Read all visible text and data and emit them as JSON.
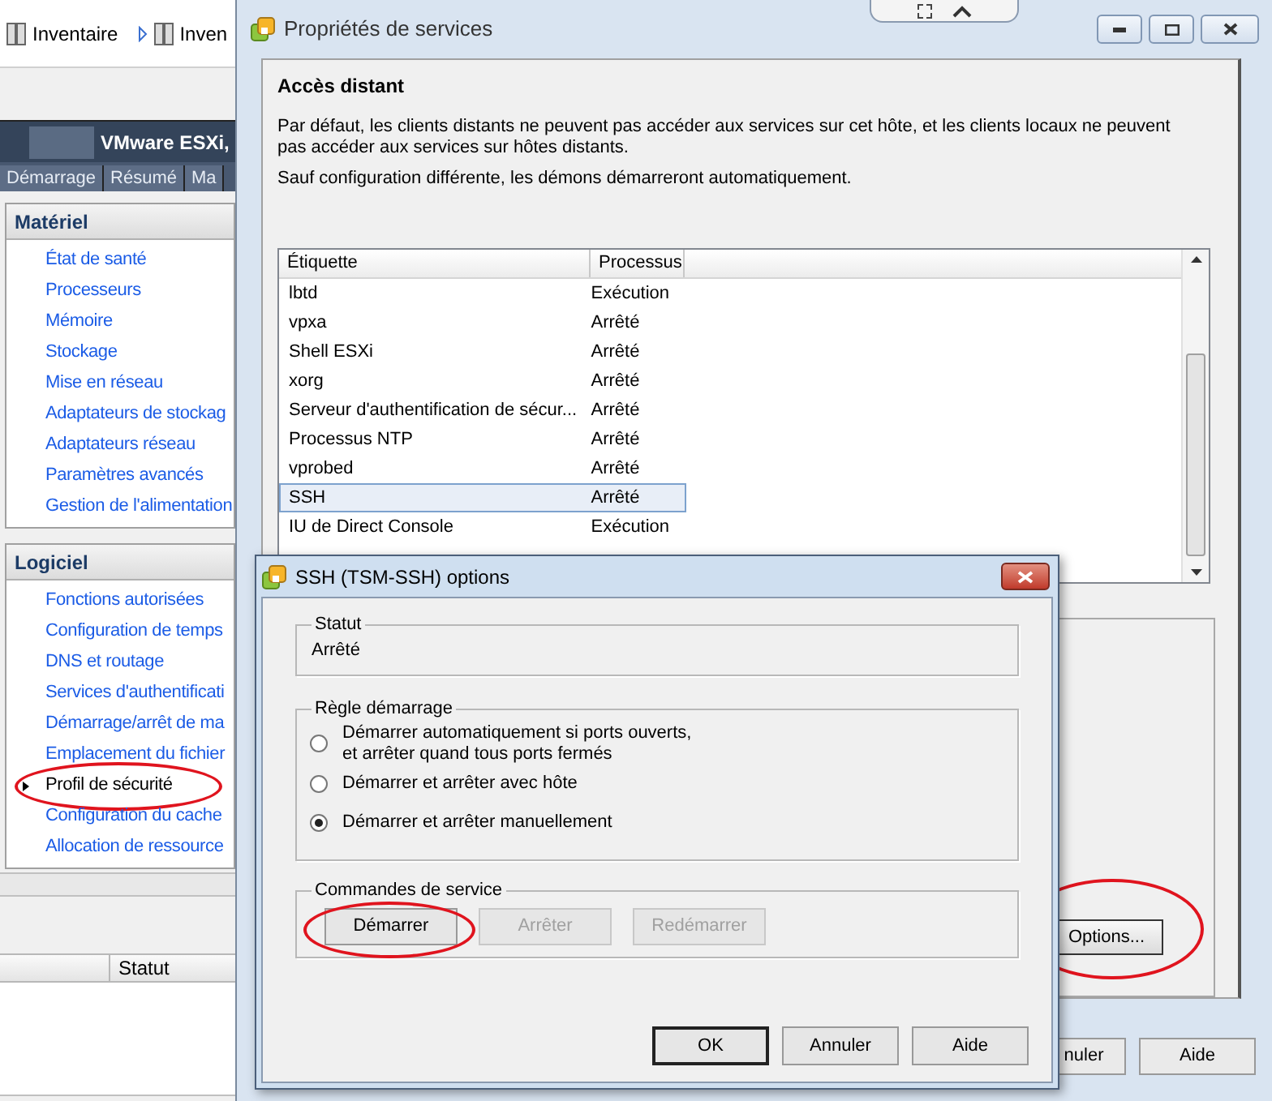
{
  "background_app": {
    "toolbar": [
      {
        "label": "Inventaire"
      },
      {
        "label": "Inven"
      }
    ],
    "host_title": "VMware ESXi,",
    "tabs": [
      {
        "label": "Démarrage"
      },
      {
        "label": "Résumé"
      },
      {
        "label": "Ma"
      }
    ],
    "sections": [
      {
        "title": "Matériel",
        "items": [
          {
            "label": "État de santé",
            "selected": false,
            "circled": false
          },
          {
            "label": "Processeurs",
            "selected": false,
            "circled": false
          },
          {
            "label": "Mémoire",
            "selected": false,
            "circled": false
          },
          {
            "label": "Stockage",
            "selected": false,
            "circled": false
          },
          {
            "label": "Mise en réseau",
            "selected": false,
            "circled": false
          },
          {
            "label": "Adaptateurs de stockag",
            "selected": false,
            "circled": false
          },
          {
            "label": "Adaptateurs réseau",
            "selected": false,
            "circled": false
          },
          {
            "label": "Paramètres avancés",
            "selected": false,
            "circled": false
          },
          {
            "label": "Gestion de l'alimentation",
            "selected": false,
            "circled": false
          }
        ]
      },
      {
        "title": "Logiciel",
        "items": [
          {
            "label": "Fonctions autorisées",
            "selected": false,
            "circled": false
          },
          {
            "label": "Configuration de temps",
            "selected": false,
            "circled": false
          },
          {
            "label": "DNS et routage",
            "selected": false,
            "circled": false
          },
          {
            "label": "Services d'authentificati",
            "selected": false,
            "circled": false
          },
          {
            "label": "Démarrage/arrêt de ma",
            "selected": false,
            "circled": false
          },
          {
            "label": "Emplacement du fichier",
            "selected": false,
            "circled": false
          },
          {
            "label": "Profil de sécurité",
            "selected": true,
            "circled": true
          },
          {
            "label": "Configuration du cache",
            "selected": false,
            "circled": false
          },
          {
            "label": "Allocation de ressource",
            "selected": false,
            "circled": false
          }
        ]
      }
    ],
    "bottom_table": {
      "columns": [
        "Statut"
      ]
    }
  },
  "properties_window": {
    "title": "Propriétés de services",
    "heading": "Accès distant",
    "paragraphs": [
      "Par défaut, les clients distants ne peuvent pas accéder aux services sur cet hôte, et les clients locaux ne peuvent pas accéder aux services sur hôtes distants.",
      "Sauf configuration différente, les démons démarreront automatiquement."
    ],
    "table": {
      "columns": [
        "Étiquette",
        "Processus"
      ],
      "rows": [
        {
          "label": "lbtd",
          "process": "Exécution",
          "selected": false
        },
        {
          "label": "vpxa",
          "process": "Arrêté",
          "selected": false
        },
        {
          "label": "Shell ESXi",
          "process": "Arrêté",
          "selected": false
        },
        {
          "label": "xorg",
          "process": "Arrêté",
          "selected": false
        },
        {
          "label": "Serveur d'authentification de sécur...",
          "process": "Arrêté",
          "selected": false
        },
        {
          "label": "Processus NTP",
          "process": "Arrêté",
          "selected": false
        },
        {
          "label": "vprobed",
          "process": "Arrêté",
          "selected": false
        },
        {
          "label": "SSH",
          "process": "Arrêté",
          "selected": true
        },
        {
          "label": "IU de Direct Console",
          "process": "Exécution",
          "selected": false
        }
      ]
    },
    "options_button": {
      "label": "Options...",
      "circled": true
    },
    "buttons": [
      "nuler",
      "Aide"
    ]
  },
  "options_dialog": {
    "title": "SSH (TSM-SSH) options",
    "status": {
      "legend": "Statut",
      "value": "Arrêté"
    },
    "startup_policy": {
      "legend": "Règle démarrage",
      "options": [
        {
          "label": "Démarrer automatiquement si ports ouverts,\net arrêter quand tous ports fermés",
          "selected": false
        },
        {
          "label": "Démarrer et arrêter avec hôte",
          "selected": false
        },
        {
          "label": "Démarrer et arrêter manuellement",
          "selected": true
        }
      ]
    },
    "service_commands": {
      "legend": "Commandes de service",
      "buttons": [
        {
          "label": "Démarrer",
          "disabled": false,
          "circled": true
        },
        {
          "label": "Arrêter",
          "disabled": true,
          "circled": false
        },
        {
          "label": "Redémarrer",
          "disabled": true,
          "circled": false
        }
      ]
    },
    "buttons": [
      {
        "label": "OK",
        "default": true
      },
      {
        "label": "Annuler",
        "default": false
      },
      {
        "label": "Aide",
        "default": false
      }
    ]
  }
}
